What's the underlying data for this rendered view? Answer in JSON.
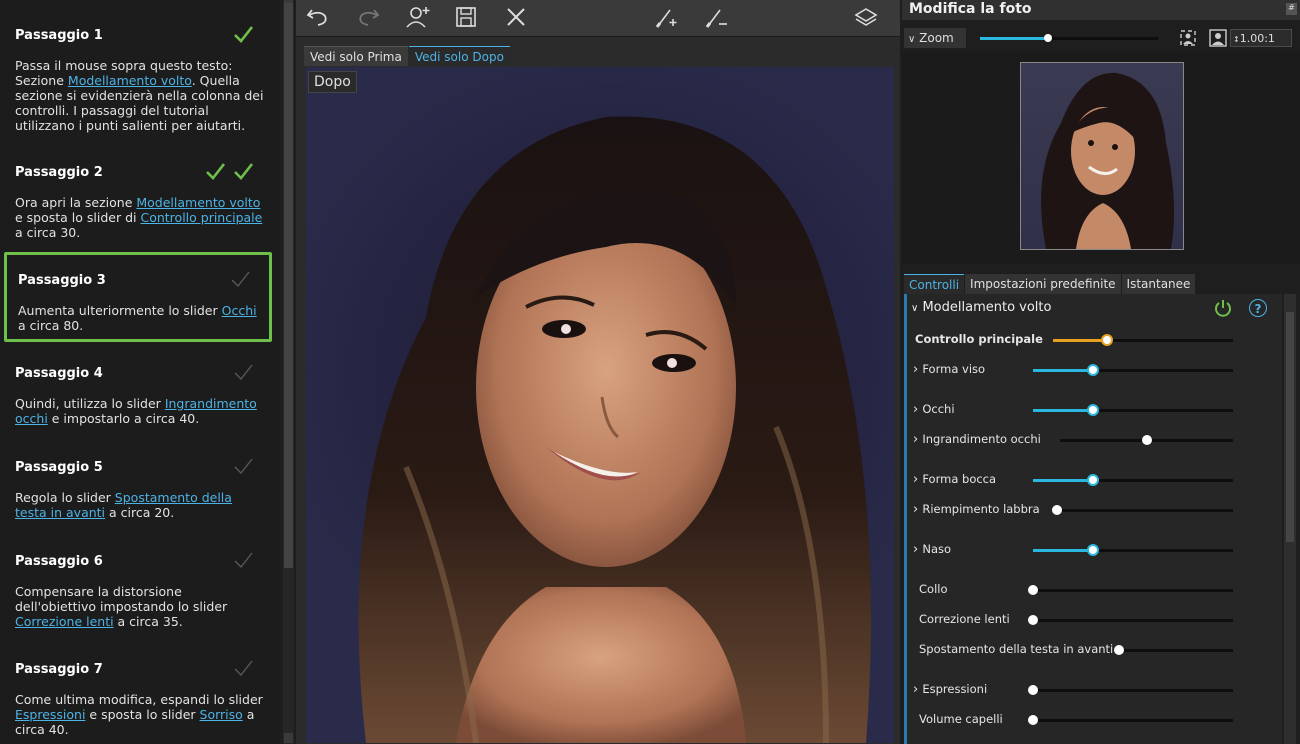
{
  "tutorial": {
    "steps": [
      {
        "title": "Passaggio 1",
        "checks": "done1",
        "text_a": "Passa il mouse sopra questo testo: Sezione ",
        "link_a": "Modellamento volto",
        "text_b": ". Quella sezione si evidenzierà nella colonna dei controlli. I passaggi del tutorial utilizzano i punti salienti per aiutarti.",
        "link_b": "",
        "text_c": ""
      },
      {
        "title": "Passaggio 2",
        "checks": "done2",
        "text_a": "Ora apri la sezione ",
        "link_a": "Modellamento volto",
        "text_b": " e sposta lo slider di ",
        "link_b": "Controllo principale",
        "text_c": " a circa 30."
      },
      {
        "title": "Passaggio 3",
        "checks": "pending",
        "text_a": "Aumenta ulteriormente lo slider ",
        "link_a": "Occhi",
        "text_b": " a circa 80.",
        "link_b": "",
        "text_c": ""
      },
      {
        "title": "Passaggio 4",
        "checks": "pending",
        "text_a": "Quindi, utilizza lo slider ",
        "link_a": "Ingrandimento occhi",
        "text_b": " e impostarlo a circa 40.",
        "link_b": "",
        "text_c": ""
      },
      {
        "title": "Passaggio 5",
        "checks": "pending",
        "text_a": "Regola lo slider ",
        "link_a": "Spostamento della testa in avanti",
        "text_b": " a circa 20.",
        "link_b": "",
        "text_c": ""
      },
      {
        "title": "Passaggio 6",
        "checks": "pending",
        "text_a": "Compensare la distorsione dell'obiettivo impostando lo slider ",
        "link_a": "Correzione lenti",
        "text_b": " a circa 35.",
        "link_b": "",
        "text_c": ""
      },
      {
        "title": "Passaggio 7",
        "checks": "pending",
        "text_a": "Come ultima modifica, espandi lo slider ",
        "link_a": "Espressioni",
        "text_b": " e sposta lo slider ",
        "link_b": "Sorriso",
        "text_c": " a circa 40."
      }
    ]
  },
  "center": {
    "toolbar_icons": [
      "undo-icon",
      "redo-icon",
      "add-person-icon",
      "save-icon",
      "close-x-icon",
      "brush-add-icon",
      "brush-remove-icon",
      "layers-icon"
    ],
    "view_tabs": [
      "Vedi solo Prima",
      "Vedi solo Dopo"
    ],
    "photo_label": "Dopo"
  },
  "right": {
    "title": "Modifica la foto",
    "zoom_label": "Zoom",
    "zoom_value": "1.00:1",
    "zoom_level": 0.38,
    "tabs": [
      "Controlli",
      "Impostazioni predefinite",
      "Istantanee"
    ],
    "section_title": "Modellamento volto",
    "sliders": [
      {
        "label": "Controllo principale",
        "expandable": false,
        "bold": true,
        "value": 0.3,
        "color": "#e8a020"
      },
      {
        "label": "Forma viso",
        "expandable": true,
        "bold": false,
        "value": 0.3,
        "color": "#2ab8e0"
      },
      {
        "label": "Occhi",
        "expandable": true,
        "bold": false,
        "value": 0.3,
        "color": "#2ab8e0"
      },
      {
        "label": "Ingrandimento occhi",
        "expandable": true,
        "bold": false,
        "value": 0.5,
        "color": null
      },
      {
        "label": "Forma bocca",
        "expandable": true,
        "bold": false,
        "value": 0.3,
        "color": "#2ab8e0"
      },
      {
        "label": "Riempimento labbra",
        "expandable": true,
        "bold": false,
        "value": 0.0,
        "color": null
      },
      {
        "label": "Naso",
        "expandable": true,
        "bold": false,
        "value": 0.3,
        "color": "#2ab8e0"
      },
      {
        "label": "Collo",
        "expandable": false,
        "bold": false,
        "value": 0.0,
        "color": null
      },
      {
        "label": "Correzione lenti",
        "expandable": false,
        "bold": false,
        "value": 0.0,
        "color": null
      },
      {
        "label": "Spostamento della testa in avanti",
        "expandable": false,
        "bold": false,
        "value": 0.0,
        "color": null
      },
      {
        "label": "Espressioni",
        "expandable": true,
        "bold": false,
        "value": 0.0,
        "color": null
      },
      {
        "label": "Volume capelli",
        "expandable": false,
        "bold": false,
        "value": 0.0,
        "color": null
      }
    ]
  }
}
